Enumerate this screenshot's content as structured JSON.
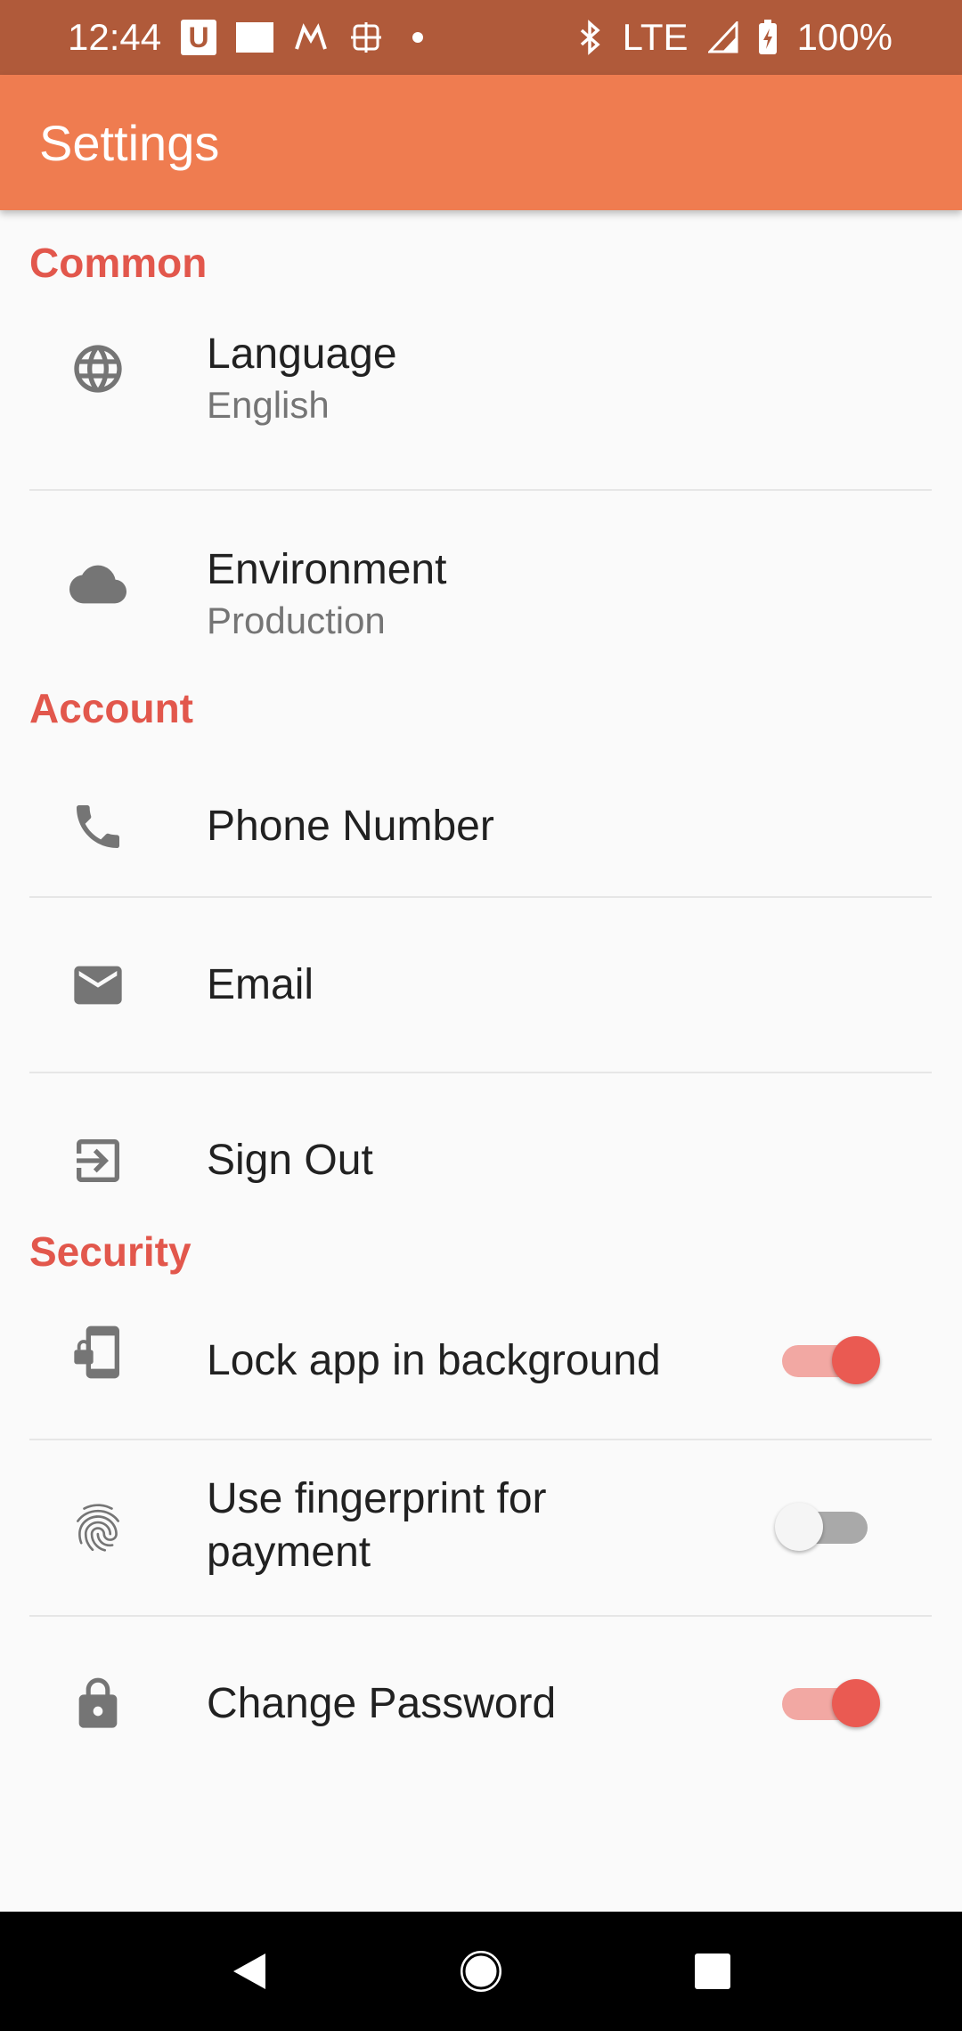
{
  "status_bar": {
    "time": "12:44",
    "notification_icons": [
      "u-icon",
      "zomato-icon",
      "mail-app-icon",
      "grid-app-icon"
    ],
    "network": "LTE",
    "battery": "100%"
  },
  "app_bar": {
    "title": "Settings"
  },
  "sections": {
    "common": {
      "header": "Common",
      "language": {
        "title": "Language",
        "subtitle": "English",
        "icon": "globe-icon"
      },
      "environment": {
        "title": "Environment",
        "subtitle": "Production",
        "icon": "cloud-icon"
      }
    },
    "account": {
      "header": "Account",
      "phone": {
        "title": "Phone Number",
        "icon": "phone-icon"
      },
      "email": {
        "title": "Email",
        "icon": "mail-icon"
      },
      "sign_out": {
        "title": "Sign Out",
        "icon": "sign-out-icon"
      }
    },
    "security": {
      "header": "Security",
      "lock_app": {
        "title": "Lock app in background",
        "icon": "phone-lock-icon",
        "enabled": true
      },
      "fingerprint": {
        "title": "Use fingerprint for payment",
        "icon": "fingerprint-icon",
        "enabled": false
      },
      "change_password": {
        "title": "Change Password",
        "icon": "lock-icon",
        "enabled": true
      }
    }
  },
  "colors": {
    "status_bar": "#b05a3a",
    "app_bar": "#ef7c50",
    "section_header": "#e2574c",
    "toggle_on_thumb": "#ea5a52",
    "toggle_on_track": "#f2a8a3"
  },
  "nav_bar": {
    "buttons": [
      "back-icon",
      "home-icon",
      "recents-icon"
    ]
  }
}
